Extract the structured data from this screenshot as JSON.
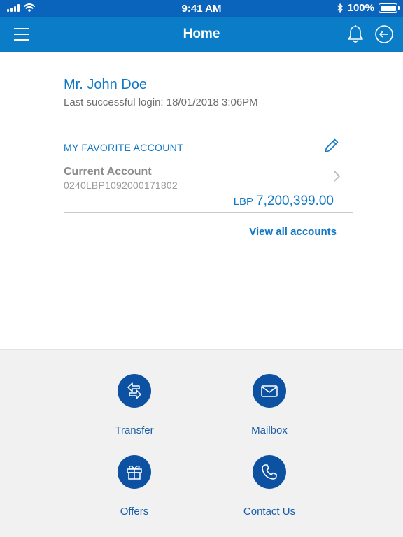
{
  "status_bar": {
    "time": "9:41 AM",
    "battery": "100%"
  },
  "nav": {
    "title": "Home"
  },
  "user": {
    "name": "Mr. John Doe",
    "last_login": "Last successful login: 18/01/2018 3:06PM"
  },
  "favorite": {
    "title": "MY FAVORITE ACCOUNT",
    "account": {
      "name": "Current Account",
      "number": "0240LBP1092000171802",
      "currency": "LBP",
      "balance": "7,200,399.00"
    }
  },
  "view_all_label": "View all accounts",
  "actions": [
    {
      "label": "Transfer",
      "icon": "transfer-icon"
    },
    {
      "label": "Mailbox",
      "icon": "mail-icon"
    },
    {
      "label": "Offers",
      "icon": "gift-icon"
    },
    {
      "label": "Contact Us",
      "icon": "phone-icon"
    }
  ],
  "colors": {
    "status_bar": "#0b64bc",
    "nav_bar": "#0b7cc8",
    "accent": "#1278c4",
    "action_circle": "#0d52a2",
    "panel": "#f1f1f1"
  }
}
